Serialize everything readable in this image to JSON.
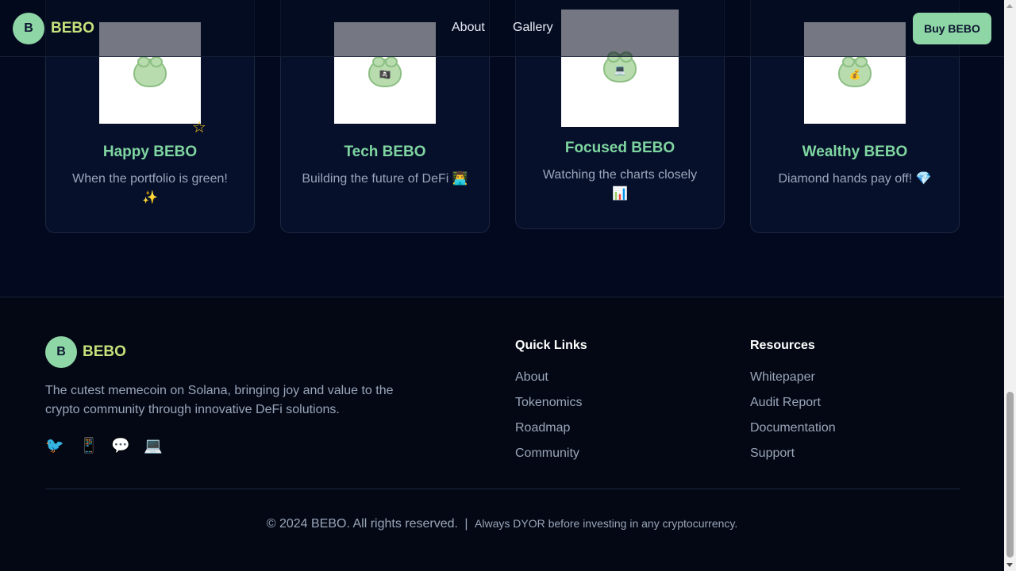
{
  "header": {
    "logo_letter": "B",
    "logo_text": "BEBO",
    "nav": {
      "about": "About",
      "gallery": "Gallery"
    },
    "buy_button": "Buy BEBO"
  },
  "gallery": {
    "cards": [
      {
        "title": "Happy BEBO",
        "desc": "When the portfolio is green! ✨",
        "prop": ""
      },
      {
        "title": "Tech BEBO",
        "desc": "Building the future of DeFi 👨‍💻",
        "prop": "🏴‍☠️"
      },
      {
        "title": "Focused BEBO",
        "desc": "Watching the charts closely 📊",
        "prop": "💻"
      },
      {
        "title": "Wealthy BEBO",
        "desc": "Diamond hands pay off! 💎",
        "prop": "💰"
      }
    ],
    "deco_star": "☆"
  },
  "footer": {
    "logo_letter": "B",
    "logo_text": "BEBO",
    "description": "The cutest memecoin on Solana, bringing joy and value to the crypto community through innovative DeFi solutions.",
    "social": [
      "🐦",
      "📱",
      "💬",
      "💻"
    ],
    "quick_links": {
      "title": "Quick Links",
      "items": [
        "About",
        "Tokenomics",
        "Roadmap",
        "Community"
      ]
    },
    "resources": {
      "title": "Resources",
      "items": [
        "Whitepaper",
        "Audit Report",
        "Documentation",
        "Support"
      ]
    },
    "copyright": "© 2024 BEBO. All rights reserved.",
    "separator": "|",
    "disclaimer": "Always DYOR before investing in any cryptocurrency."
  },
  "colors": {
    "accent_green": "#8fd6a6",
    "logo_yellow": "#c7e27a",
    "card_title": "#7fd6a0",
    "background": "#030a1f"
  }
}
